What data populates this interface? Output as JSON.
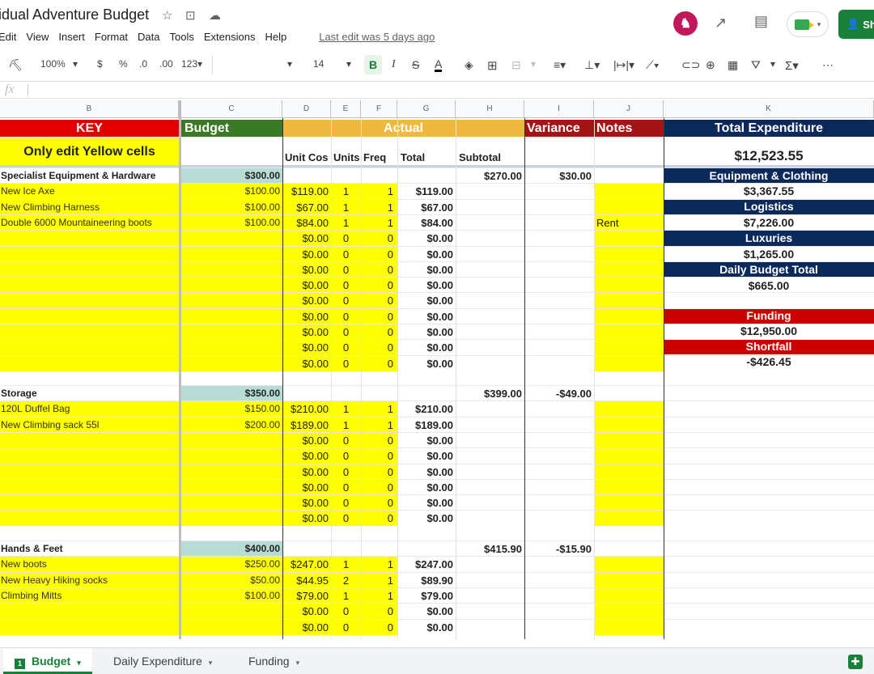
{
  "header": {
    "title": "idual Adventure Budget",
    "menus": [
      "Edit",
      "View",
      "Insert",
      "Format",
      "Data",
      "Tools",
      "Extensions",
      "Help"
    ],
    "last_edit": "Last edit was 5 days ago",
    "share_label": "Sh"
  },
  "toolbar": {
    "zoom": "100%",
    "currency": "$",
    "percent": "%",
    "dec_less": ".0",
    "dec_more": ".00",
    "format": "123",
    "font_size": "14"
  },
  "columns": [
    "B",
    "C",
    "D",
    "E",
    "F",
    "G",
    "H",
    "I",
    "J",
    "K"
  ],
  "key": {
    "key_label": "KEY",
    "key_note": "Only edit Yellow cells",
    "budget_label": "Budget",
    "actual_label": "Actual",
    "variance_label": "Variance",
    "notes_label": "Notes",
    "unit_cost": "Unit Cos",
    "units": "Units",
    "freq": "Freq",
    "total": "Total",
    "subtotal": "Subtotal"
  },
  "summary": {
    "title": "Total Expenditure",
    "total": "$12,523.55",
    "items": [
      {
        "label": "Equipment & Clothing",
        "value": "$3,367.55"
      },
      {
        "label": "Logistics",
        "value": "$7,226.00"
      },
      {
        "label": "Luxuries",
        "value": "$1,265.00"
      },
      {
        "label": "Daily Budget Total",
        "value": "$665.00"
      }
    ],
    "funding_label": "Funding",
    "funding_value": "$12,950.00",
    "shortfall_label": "Shortfall",
    "shortfall_value": "-$426.45"
  },
  "sections": [
    {
      "name": "Specialist Equipment & Hardware",
      "budget": "$300.00",
      "subtotal": "$270.00",
      "variance": "$30.00",
      "rows": [
        {
          "item": "New Ice Axe",
          "budget": "$100.00",
          "unit": "$119.00",
          "units": "1",
          "freq": "1",
          "total": "$119.00",
          "note": ""
        },
        {
          "item": "New Climbing Harness",
          "budget": "$100.00",
          "unit": "$67.00",
          "units": "1",
          "freq": "1",
          "total": "$67.00",
          "note": ""
        },
        {
          "item": "Double 6000 Mountaineering boots",
          "budget": "$100.00",
          "unit": "$84.00",
          "units": "1",
          "freq": "1",
          "total": "$84.00",
          "note": "Rent"
        },
        {
          "item": "",
          "budget": "",
          "unit": "$0.00",
          "units": "0",
          "freq": "0",
          "total": "$0.00",
          "note": ""
        },
        {
          "item": "",
          "budget": "",
          "unit": "$0.00",
          "units": "0",
          "freq": "0",
          "total": "$0.00",
          "note": ""
        },
        {
          "item": "",
          "budget": "",
          "unit": "$0.00",
          "units": "0",
          "freq": "0",
          "total": "$0.00",
          "note": ""
        },
        {
          "item": "",
          "budget": "",
          "unit": "$0.00",
          "units": "0",
          "freq": "0",
          "total": "$0.00",
          "note": ""
        },
        {
          "item": "",
          "budget": "",
          "unit": "$0.00",
          "units": "0",
          "freq": "0",
          "total": "$0.00",
          "note": ""
        },
        {
          "item": "",
          "budget": "",
          "unit": "$0.00",
          "units": "0",
          "freq": "0",
          "total": "$0.00",
          "note": ""
        },
        {
          "item": "",
          "budget": "",
          "unit": "$0.00",
          "units": "0",
          "freq": "0",
          "total": "$0.00",
          "note": ""
        },
        {
          "item": "",
          "budget": "",
          "unit": "$0.00",
          "units": "0",
          "freq": "0",
          "total": "$0.00",
          "note": ""
        },
        {
          "item": "",
          "budget": "",
          "unit": "$0.00",
          "units": "0",
          "freq": "0",
          "total": "$0.00",
          "note": ""
        }
      ]
    },
    {
      "name": "Storage",
      "budget": "$350.00",
      "subtotal": "$399.00",
      "variance": "-$49.00",
      "rows": [
        {
          "item": "120L Duffel Bag",
          "budget": "$150.00",
          "unit": "$210.00",
          "units": "1",
          "freq": "1",
          "total": "$210.00",
          "note": ""
        },
        {
          "item": "New Climbing sack 55l",
          "budget": "$200.00",
          "unit": "$189.00",
          "units": "1",
          "freq": "1",
          "total": "$189.00",
          "note": ""
        },
        {
          "item": "",
          "budget": "",
          "unit": "$0.00",
          "units": "0",
          "freq": "0",
          "total": "$0.00",
          "note": ""
        },
        {
          "item": "",
          "budget": "",
          "unit": "$0.00",
          "units": "0",
          "freq": "0",
          "total": "$0.00",
          "note": ""
        },
        {
          "item": "",
          "budget": "",
          "unit": "$0.00",
          "units": "0",
          "freq": "0",
          "total": "$0.00",
          "note": ""
        },
        {
          "item": "",
          "budget": "",
          "unit": "$0.00",
          "units": "0",
          "freq": "0",
          "total": "$0.00",
          "note": ""
        },
        {
          "item": "",
          "budget": "",
          "unit": "$0.00",
          "units": "0",
          "freq": "0",
          "total": "$0.00",
          "note": ""
        },
        {
          "item": "",
          "budget": "",
          "unit": "$0.00",
          "units": "0",
          "freq": "0",
          "total": "$0.00",
          "note": ""
        }
      ]
    },
    {
      "name": "Hands & Feet",
      "budget": "$400.00",
      "subtotal": "$415.90",
      "variance": "-$15.90",
      "rows": [
        {
          "item": "New boots",
          "budget": "$250.00",
          "unit": "$247.00",
          "units": "1",
          "freq": "1",
          "total": "$247.00",
          "note": ""
        },
        {
          "item": "New Heavy Hiking socks",
          "budget": "$50.00",
          "unit": "$44.95",
          "units": "2",
          "freq": "1",
          "total": "$89.90",
          "note": ""
        },
        {
          "item": "Climbing Mitts",
          "budget": "$100.00",
          "unit": "$79.00",
          "units": "1",
          "freq": "1",
          "total": "$79.00",
          "note": ""
        },
        {
          "item": "",
          "budget": "",
          "unit": "$0.00",
          "units": "0",
          "freq": "0",
          "total": "$0.00",
          "note": ""
        },
        {
          "item": "",
          "budget": "",
          "unit": "$0.00",
          "units": "0",
          "freq": "0",
          "total": "$0.00",
          "note": ""
        }
      ]
    }
  ],
  "tabs": [
    "Budget",
    "Daily Expenditure",
    "Funding"
  ]
}
